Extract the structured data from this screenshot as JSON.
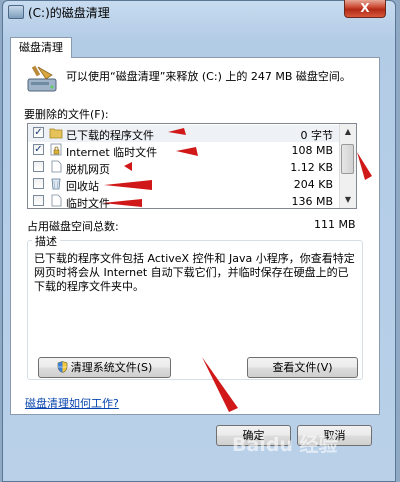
{
  "window": {
    "title": "(C:)的磁盘清理",
    "close_glyph": "X"
  },
  "tab": {
    "label": "磁盘清理"
  },
  "intro": {
    "text": "可以使用“磁盘清理”来释放 (C:) 上的 247 MB 磁盘空间。",
    "icon": "disk-cleanup-icon"
  },
  "files": {
    "label": "要删除的文件(F):",
    "items": [
      {
        "name": "已下载的程序文件",
        "size": "0 字节",
        "checked": true,
        "icon": "folder-icon"
      },
      {
        "name": "Internet 临时文件",
        "size": "108 MB",
        "checked": true,
        "icon": "lock-icon"
      },
      {
        "name": "脱机网页",
        "size": "1.12 KB",
        "checked": false,
        "icon": "page-icon"
      },
      {
        "name": "回收站",
        "size": "204 KB",
        "checked": false,
        "icon": "recycle-bin-icon"
      },
      {
        "name": "临时文件",
        "size": "136 MB",
        "checked": false,
        "icon": "page-icon"
      }
    ]
  },
  "total": {
    "label": "占用磁盘空间总数:",
    "value": "111 MB"
  },
  "description": {
    "title": "描述",
    "text": "已下载的程序文件包括 ActiveX 控件和 Java 小程序，你查看特定网页时将会从 Internet 自动下载它们，并临时保存在硬盘上的已下载的程序文件夹中。"
  },
  "buttons": {
    "clean_system": "清理系统文件(S)",
    "view_files": "查看文件(V)",
    "ok": "确定",
    "cancel": "取消"
  },
  "help_link": "磁盘清理如何工作?",
  "watermark": "Baidu 经验",
  "colors": {
    "annotation_arrow": "#d01818",
    "link": "#0645ad",
    "frame": "#b9d0e8"
  }
}
